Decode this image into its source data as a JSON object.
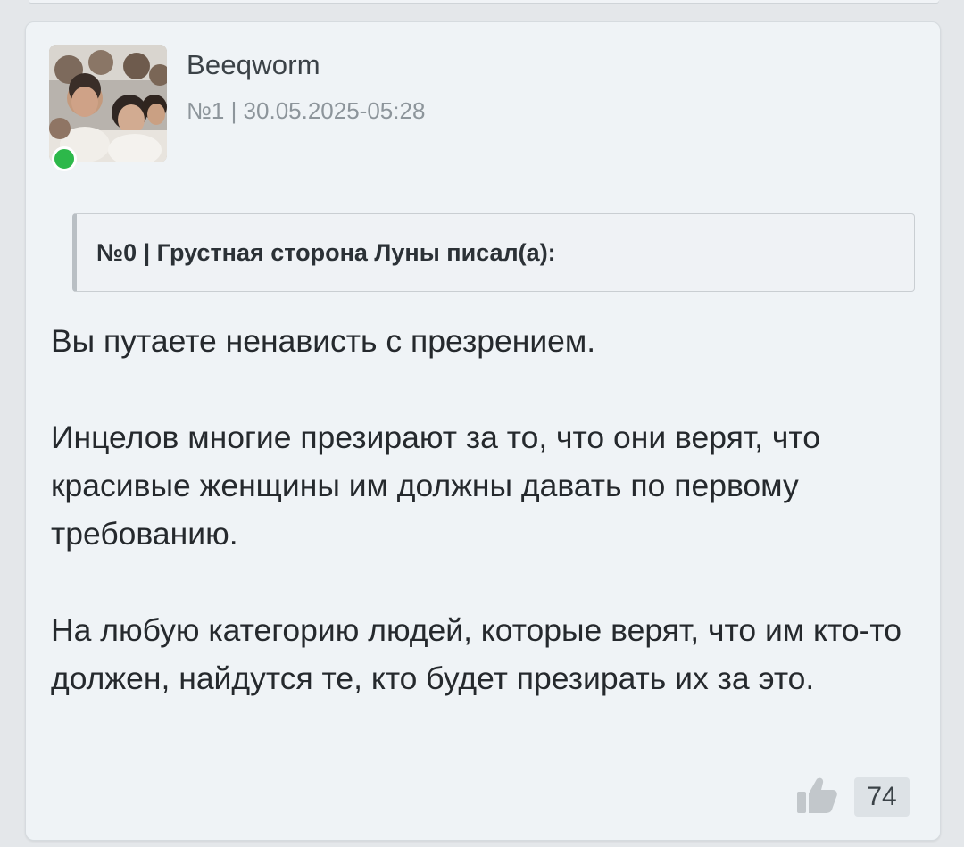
{
  "post": {
    "author": "Beeqworm",
    "meta": "№1 | 30.05.2025-05:28",
    "online": true,
    "quote_header": "№0 | Грустная сторона Луны писал(а):",
    "paragraphs": [
      "Вы путаете ненависть с презрением.",
      "Инцелов многие презирают за то, что они верят, что красивые женщины им должны давать по первому требованию.",
      "На любую категорию людей, которые верят, что им кто-то должен, найдутся те, кто будет презирать их за это."
    ],
    "likes": "74"
  },
  "colors": {
    "online": "#2db84a",
    "background": "#eff3f6"
  },
  "icons": {
    "like": "thumbs-up-icon"
  }
}
